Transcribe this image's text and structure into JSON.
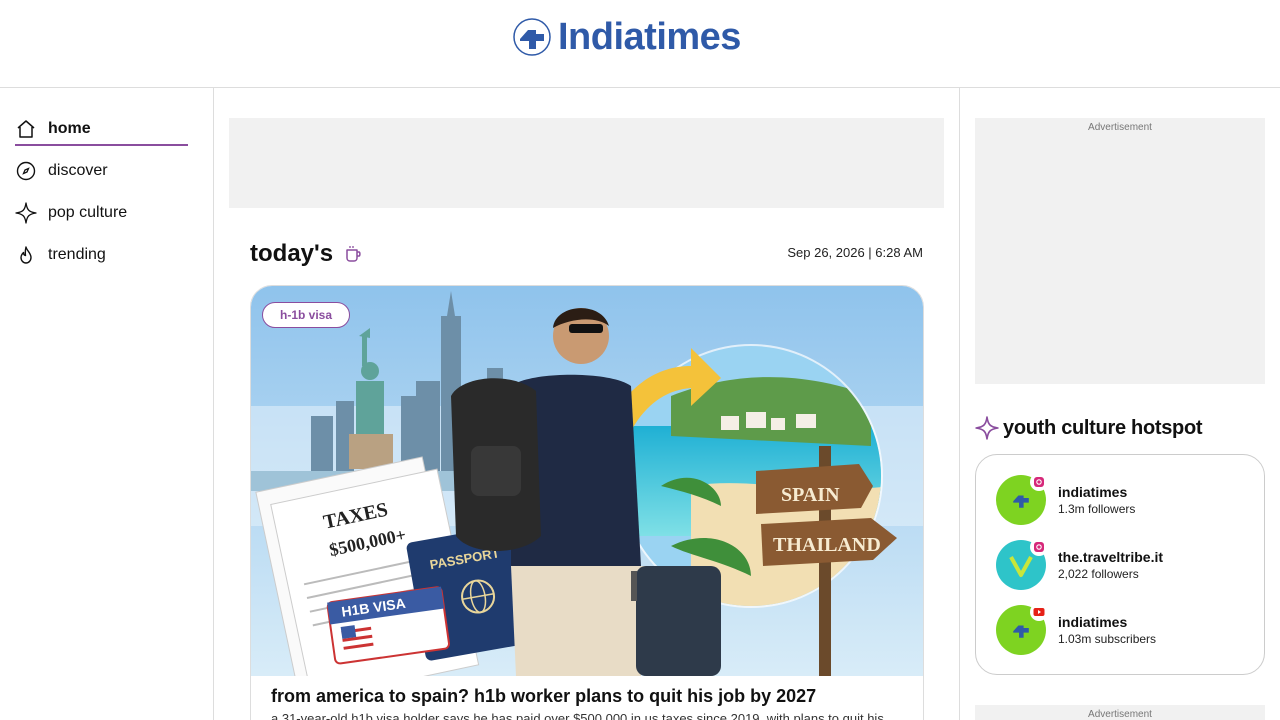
{
  "brand": {
    "name": "Indiatimes"
  },
  "nav": {
    "items": [
      {
        "label": "home",
        "icon": "home-icon",
        "active": true
      },
      {
        "label": "discover",
        "icon": "compass-icon",
        "active": false
      },
      {
        "label": "pop culture",
        "icon": "sparkle-icon",
        "active": false
      },
      {
        "label": "trending",
        "icon": "flame-icon",
        "active": false
      }
    ]
  },
  "main": {
    "section_title": "today's",
    "section_icon": "coffee-cup-icon",
    "date": "Sep 26, 2026 | 6:28 AM",
    "article": {
      "tag": "h-1b visa",
      "image_text": {
        "taxes": "TAXES",
        "amount": "$500,000+",
        "passport": "PASSPORT",
        "visa": "H1B VISA",
        "sign1": "SPAIN",
        "sign2": "THAILAND"
      },
      "headline": "from america to spain? h1b worker plans to quit his job by 2027",
      "summary": "a 31-year-old h1b visa holder says he has paid over $500,000 in us taxes since 2019, with plans to quit his"
    }
  },
  "right": {
    "ad_label": "Advertisement",
    "hotspot_title": "youth culture hotspot",
    "hotspot_icon": "sparkle-icon",
    "socials": [
      {
        "name": "indiatimes",
        "count": "1.3m followers",
        "platform": "instagram-icon",
        "avatar_color": "#7ed321"
      },
      {
        "name": "the.traveltribe.it",
        "count": "2,022 followers",
        "platform": "instagram-icon",
        "avatar_color": "#2ec4c9"
      },
      {
        "name": "indiatimes",
        "count": "1.03m subscribers",
        "platform": "youtube-icon",
        "avatar_color": "#7ed321"
      }
    ],
    "ad_bottom_label": "Advertisement"
  },
  "colors": {
    "accent": "#8a4d9e",
    "brand": "#2f5aa8"
  }
}
